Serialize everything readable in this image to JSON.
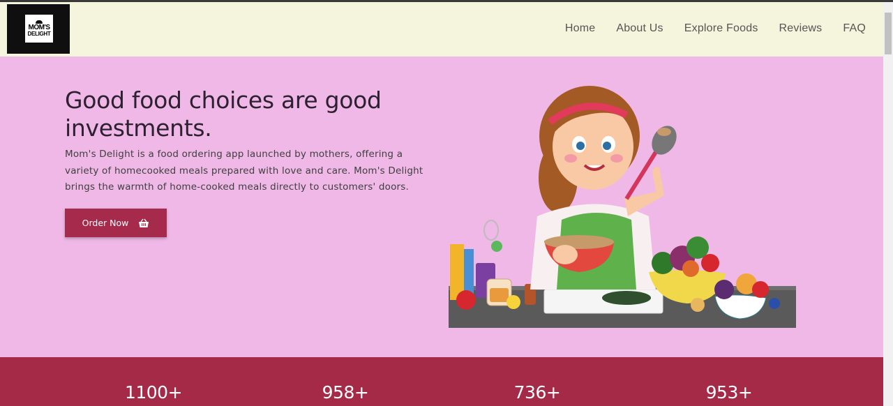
{
  "brand": {
    "logo_line1": "MOM'S",
    "logo_line2": "DELIGHT"
  },
  "nav": {
    "items": [
      "Home",
      "About Us",
      "Explore Foods",
      "Reviews",
      "FAQ"
    ]
  },
  "hero": {
    "title": "Good food choices are good investments.",
    "description": "Mom's Delight is a food ordering app launched by mothers, offering a variety of homecooked meals prepared with love and care. Mom's Delight brings the warmth of home-cooked meals directly to customers' doors.",
    "cta_label": "Order Now",
    "cta_icon": "basket-icon"
  },
  "stats": [
    "1100+",
    "958+",
    "736+",
    "953+"
  ],
  "colors": {
    "header_bg": "#f5f4dc",
    "hero_bg": "#efb8e7",
    "accent": "#a52a4c",
    "stats_bg": "#a52a48"
  }
}
